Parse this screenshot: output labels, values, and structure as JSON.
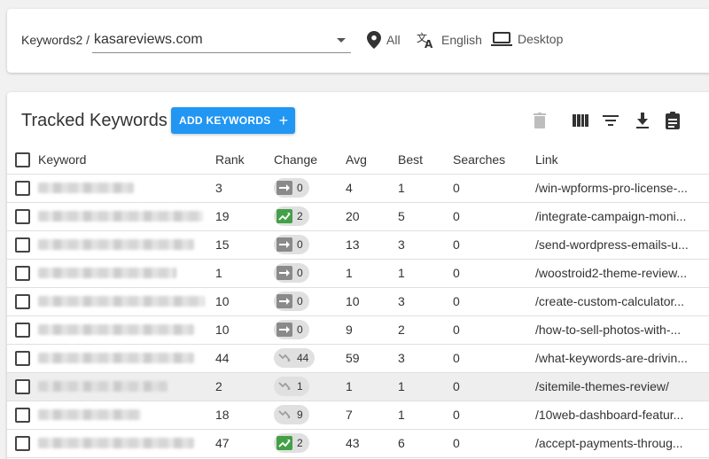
{
  "header": {
    "breadcrumb": "Keywords2 /",
    "domain": "kasareviews.com",
    "location": "All",
    "language": "English",
    "device": "Desktop"
  },
  "main": {
    "title": "Tracked Keywords",
    "add_button": "ADD KEYWORDS",
    "columns": [
      "Keyword",
      "Rank",
      "Change",
      "Avg",
      "Best",
      "Searches",
      "Link"
    ],
    "rows": [
      {
        "rank": "3",
        "trend": "flat",
        "change": "0",
        "avg": "4",
        "best": "1",
        "searches": "0",
        "link": "/win-wpforms-pro-license-..."
      },
      {
        "rank": "19",
        "trend": "up",
        "change": "2",
        "avg": "20",
        "best": "5",
        "searches": "0",
        "link": "/integrate-campaign-moni..."
      },
      {
        "rank": "15",
        "trend": "flat",
        "change": "0",
        "avg": "13",
        "best": "3",
        "searches": "0",
        "link": "/send-wordpress-emails-u..."
      },
      {
        "rank": "1",
        "trend": "flat",
        "change": "0",
        "avg": "1",
        "best": "1",
        "searches": "0",
        "link": "/woostroid2-theme-review..."
      },
      {
        "rank": "10",
        "trend": "flat",
        "change": "0",
        "avg": "10",
        "best": "3",
        "searches": "0",
        "link": "/create-custom-calculator..."
      },
      {
        "rank": "10",
        "trend": "flat",
        "change": "0",
        "avg": "9",
        "best": "2",
        "searches": "0",
        "link": "/how-to-sell-photos-with-..."
      },
      {
        "rank": "44",
        "trend": "down",
        "change": "44",
        "avg": "59",
        "best": "3",
        "searches": "0",
        "link": "/what-keywords-are-drivin..."
      },
      {
        "rank": "2",
        "trend": "down",
        "change": "1",
        "avg": "1",
        "best": "1",
        "searches": "0",
        "link": "/sitemile-themes-review/"
      },
      {
        "rank": "18",
        "trend": "down",
        "change": "9",
        "avg": "7",
        "best": "1",
        "searches": "0",
        "link": "/10web-dashboard-featur..."
      },
      {
        "rank": "47",
        "trend": "up",
        "change": "2",
        "avg": "43",
        "best": "6",
        "searches": "0",
        "link": "/accept-payments-throug..."
      }
    ]
  },
  "colors": {
    "accent": "#2196f3",
    "up": "#43a047",
    "flat": "#8a8a8a"
  }
}
